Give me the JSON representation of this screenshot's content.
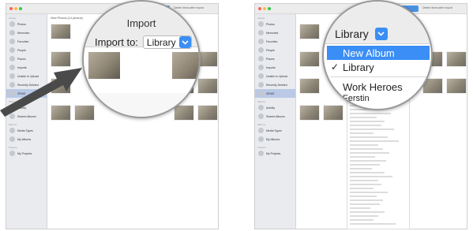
{
  "left_window": {
    "toolbar_text": "Delete items after import",
    "sidebar_heading": "Library",
    "sidebar_items": [
      {
        "label": "Photos",
        "icon": "photos-icon"
      },
      {
        "label": "Memories",
        "icon": "memories-icon"
      },
      {
        "label": "Favorites",
        "icon": "favorites-icon"
      },
      {
        "label": "People",
        "icon": "people-icon"
      },
      {
        "label": "Places",
        "icon": "places-icon"
      },
      {
        "label": "Imports",
        "icon": "imports-icon"
      },
      {
        "label": "Unable to Upload",
        "icon": "upload-icon"
      },
      {
        "label": "Recently Deleted",
        "icon": "trash-icon"
      }
    ],
    "selected_device": "ZENIS",
    "shared_heading": "Shared",
    "shared_items": [
      "Activity",
      "Shared Albums"
    ],
    "albums_heading": "Albums",
    "album_items": [
      "Media Types",
      "My Albums"
    ],
    "projects_heading": "Projects",
    "project_items": [
      "My Projects"
    ],
    "main_heading": "New Photos (14 photos)"
  },
  "import_lens": {
    "title": "Import",
    "label": "Import to:",
    "selected": "Library"
  },
  "right_window": {
    "toolbar_text": "Delete items after import"
  },
  "album_menu": {
    "selected": "Library",
    "items": [
      {
        "label": "New Album",
        "highlighted": true,
        "checked": false
      },
      {
        "label": "Library",
        "highlighted": false,
        "checked": true
      },
      {
        "label": "Work Heroes",
        "highlighted": false,
        "checked": false
      },
      {
        "label": "Ferstin",
        "highlighted": false,
        "checked": false
      }
    ]
  },
  "colors": {
    "accent": "#3a8ef6",
    "sidebar": "#e9ebef",
    "selection": "#b9c9e6"
  }
}
